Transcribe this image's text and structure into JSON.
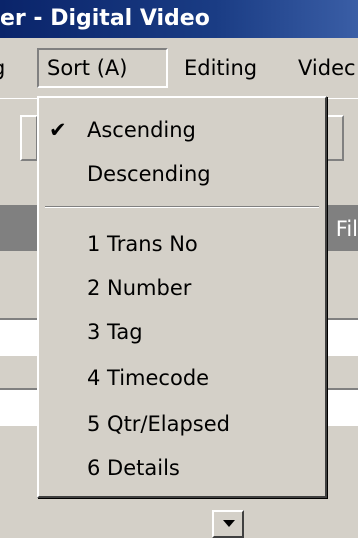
{
  "window": {
    "title": "er - Digital Video"
  },
  "menubar": {
    "items": [
      {
        "label": "g"
      },
      {
        "label": "Sort (A)"
      },
      {
        "label": "Editing"
      },
      {
        "label": "Videc"
      }
    ]
  },
  "background": {
    "column_header_fragment": "Fil"
  },
  "sort_menu": {
    "items": [
      {
        "label": "Ascending",
        "checked": true,
        "check_glyph": "✔"
      },
      {
        "label": "Descending",
        "checked": false
      },
      {
        "label": "1 Trans No"
      },
      {
        "label": "2 Number"
      },
      {
        "label": "3 Tag"
      },
      {
        "label": "4 Timecode"
      },
      {
        "label": "5 Qtr/Elapsed"
      },
      {
        "label": "6 Details"
      }
    ]
  },
  "icons": {
    "dropdown_arrow": "chevron-down-icon",
    "checkmark": "checkmark-icon"
  }
}
